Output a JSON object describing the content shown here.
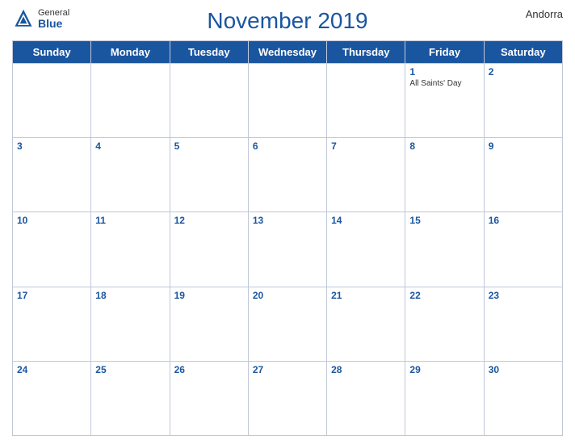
{
  "header": {
    "title": "November 2019",
    "country": "Andorra",
    "logo": {
      "general": "General",
      "blue": "Blue"
    }
  },
  "days_of_week": [
    "Sunday",
    "Monday",
    "Tuesday",
    "Wednesday",
    "Thursday",
    "Friday",
    "Saturday"
  ],
  "weeks": [
    [
      {
        "date": "",
        "holiday": ""
      },
      {
        "date": "",
        "holiday": ""
      },
      {
        "date": "",
        "holiday": ""
      },
      {
        "date": "",
        "holiday": ""
      },
      {
        "date": "",
        "holiday": ""
      },
      {
        "date": "1",
        "holiday": "All Saints' Day"
      },
      {
        "date": "2",
        "holiday": ""
      }
    ],
    [
      {
        "date": "3",
        "holiday": ""
      },
      {
        "date": "4",
        "holiday": ""
      },
      {
        "date": "5",
        "holiday": ""
      },
      {
        "date": "6",
        "holiday": ""
      },
      {
        "date": "7",
        "holiday": ""
      },
      {
        "date": "8",
        "holiday": ""
      },
      {
        "date": "9",
        "holiday": ""
      }
    ],
    [
      {
        "date": "10",
        "holiday": ""
      },
      {
        "date": "11",
        "holiday": ""
      },
      {
        "date": "12",
        "holiday": ""
      },
      {
        "date": "13",
        "holiday": ""
      },
      {
        "date": "14",
        "holiday": ""
      },
      {
        "date": "15",
        "holiday": ""
      },
      {
        "date": "16",
        "holiday": ""
      }
    ],
    [
      {
        "date": "17",
        "holiday": ""
      },
      {
        "date": "18",
        "holiday": ""
      },
      {
        "date": "19",
        "holiday": ""
      },
      {
        "date": "20",
        "holiday": ""
      },
      {
        "date": "21",
        "holiday": ""
      },
      {
        "date": "22",
        "holiday": ""
      },
      {
        "date": "23",
        "holiday": ""
      }
    ],
    [
      {
        "date": "24",
        "holiday": ""
      },
      {
        "date": "25",
        "holiday": ""
      },
      {
        "date": "26",
        "holiday": ""
      },
      {
        "date": "27",
        "holiday": ""
      },
      {
        "date": "28",
        "holiday": ""
      },
      {
        "date": "29",
        "holiday": ""
      },
      {
        "date": "30",
        "holiday": ""
      }
    ]
  ],
  "colors": {
    "header_bg": "#1a56a0",
    "header_text": "#ffffff",
    "border": "#c0c8d8",
    "day_number": "#1a56a0"
  }
}
